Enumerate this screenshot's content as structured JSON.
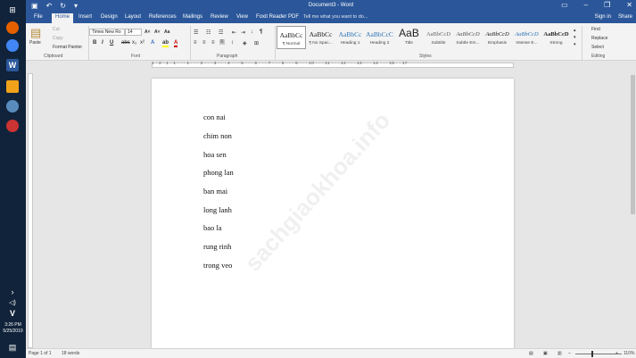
{
  "taskbar": {
    "time": "3:26 PM",
    "date": "5/25/2019"
  },
  "window": {
    "title": "Document3 - Word",
    "sign_in": "Sign in",
    "share": "Share"
  },
  "tabs": [
    "File",
    "Home",
    "Insert",
    "Design",
    "Layout",
    "References",
    "Mailings",
    "Review",
    "View",
    "Foxit Reader PDF"
  ],
  "active_tab": "Home",
  "tell_me": {
    "placeholder": "Tell me what you want to do..."
  },
  "clipboard": {
    "paste": "Paste",
    "cut": "Cut",
    "copy": "Copy",
    "format_painter": "Format Painter",
    "label": "Clipboard"
  },
  "font": {
    "family": "Times New Ro",
    "size": "14",
    "label": "Font"
  },
  "paragraph": {
    "label": "Paragraph"
  },
  "styles": {
    "label": "Styles",
    "items": [
      {
        "preview": "AaBbCc",
        "name": "¶ Normal"
      },
      {
        "preview": "AaBbCc",
        "name": "¶ No Spac..."
      },
      {
        "preview": "AaBbCc",
        "name": "Heading 1"
      },
      {
        "preview": "AaBbCcC",
        "name": "Heading 2"
      },
      {
        "preview": "AaB",
        "name": "Title"
      },
      {
        "preview": "AaBbCcD",
        "name": "Subtitle"
      },
      {
        "preview": "AaBbCcD",
        "name": "Subtle Em..."
      },
      {
        "preview": "AaBbCcD",
        "name": "Emphasis"
      },
      {
        "preview": "AaBbCcD",
        "name": "Intense E..."
      },
      {
        "preview": "AaBbCcD",
        "name": "Strong"
      }
    ]
  },
  "editing": {
    "find": "Find",
    "replace": "Replace",
    "select": "Select",
    "label": "Editing"
  },
  "ruler": {
    "marks": "1 · 2 · 1 · 1 · · · 1 · · · 2 · · · 3 · · · 4 · · · 5 · · · 6 · · · 7 · · · 8 · · · 9 · · · 10 · · · 11 · · · 12 · · · 13 · · · 14 · · · 15 · · 17"
  },
  "document": {
    "lines": [
      "con nai",
      "chim non",
      "hoa sen",
      "phong lan",
      "ban mai",
      "long lanh",
      "bao la",
      "rung rinh",
      "trong veo"
    ],
    "watermark": "sachgiaokhoa.info"
  },
  "status": {
    "page": "Page 1 of 1",
    "words": "18 words",
    "zoom": "110%"
  }
}
